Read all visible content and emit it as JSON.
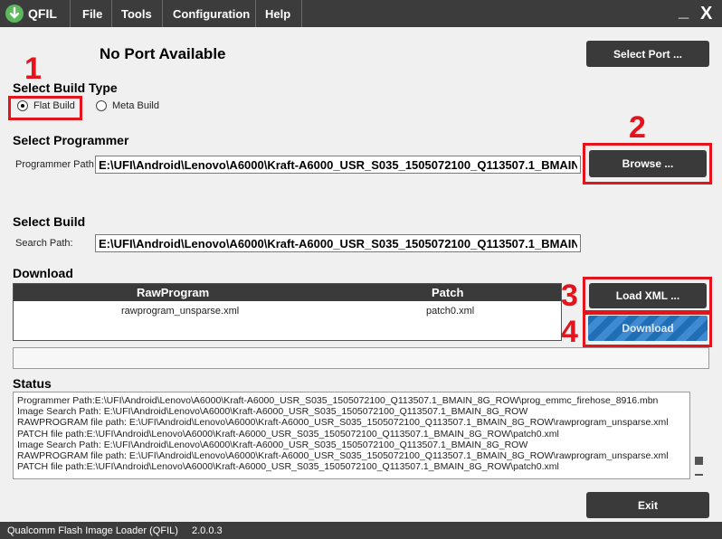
{
  "app": {
    "name": "QFIL"
  },
  "menu": [
    "File",
    "Tools",
    "Configuration",
    "Help"
  ],
  "window_controls": {
    "minimize": "_",
    "close": "X"
  },
  "port": {
    "status": "No Port Available",
    "select_button": "Select Port ..."
  },
  "build_type": {
    "title": "Select Build Type",
    "options": [
      "Flat Build",
      "Meta Build"
    ],
    "selected": "Flat Build"
  },
  "programmer": {
    "title": "Select Programmer",
    "label": "Programmer Path",
    "value": "E:\\UFI\\Android\\Lenovo\\A6000\\Kraft-A6000_USR_S035_1505072100_Q113507.1_BMAIN_8G_ROW\\prog_emmc_firehose_8916.mbn",
    "browse_button": "Browse ..."
  },
  "build": {
    "title": "Select Build",
    "label": "Search Path:",
    "value": "E:\\UFI\\Android\\Lenovo\\A6000\\Kraft-A6000_USR_S035_1505072100_Q113507.1_BMAIN_8G_ROW"
  },
  "download": {
    "title": "Download",
    "columns": [
      "RawProgram",
      "Patch"
    ],
    "rows": [
      [
        "rawprogram_unsparse.xml",
        "patch0.xml"
      ]
    ],
    "load_xml_button": "Load XML ...",
    "download_button": "Download"
  },
  "annotations": [
    "1",
    "2",
    "3",
    "4"
  ],
  "annotation_color": "#e3141b",
  "status": {
    "title": "Status",
    "lines": [
      "Programmer Path:E:\\UFI\\Android\\Lenovo\\A6000\\Kraft-A6000_USR_S035_1505072100_Q113507.1_BMAIN_8G_ROW\\prog_emmc_firehose_8916.mbn",
      "Image Search Path: E:\\UFI\\Android\\Lenovo\\A6000\\Kraft-A6000_USR_S035_1505072100_Q113507.1_BMAIN_8G_ROW",
      "RAWPROGRAM file path: E:\\UFI\\Android\\Lenovo\\A6000\\Kraft-A6000_USR_S035_1505072100_Q113507.1_BMAIN_8G_ROW\\rawprogram_unsparse.xml",
      "PATCH file path:E:\\UFI\\Android\\Lenovo\\A6000\\Kraft-A6000_USR_S035_1505072100_Q113507.1_BMAIN_8G_ROW\\patch0.xml",
      "Image Search Path: E:\\UFI\\Android\\Lenovo\\A6000\\Kraft-A6000_USR_S035_1505072100_Q113507.1_BMAIN_8G_ROW",
      "RAWPROGRAM file path: E:\\UFI\\Android\\Lenovo\\A6000\\Kraft-A6000_USR_S035_1505072100_Q113507.1_BMAIN_8G_ROW\\rawprogram_unsparse.xml",
      "PATCH file path:E:\\UFI\\Android\\Lenovo\\A6000\\Kraft-A6000_USR_S035_1505072100_Q113507.1_BMAIN_8G_ROW\\patch0.xml"
    ]
  },
  "exit_button": "Exit",
  "footer": {
    "app_title": "Qualcomm Flash Image Loader (QFIL)",
    "version": "2.0.0.3"
  }
}
